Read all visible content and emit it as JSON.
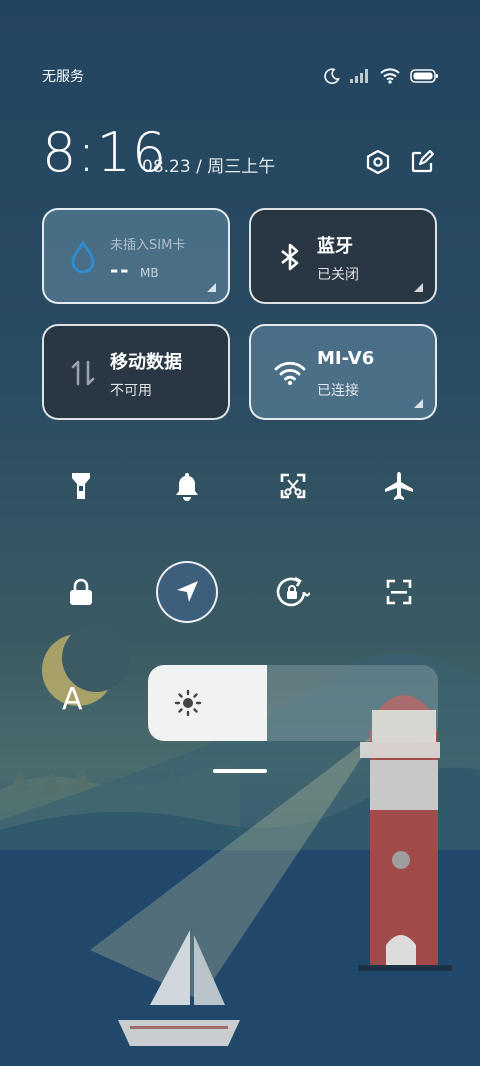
{
  "status_bar": {
    "carrier": "无服务",
    "icons": [
      "moon-icon",
      "signal-icon",
      "wifi-icon",
      "battery-icon"
    ]
  },
  "header": {
    "time": "8:16",
    "date": "08.23 / 周三上午",
    "buttons": [
      "settings-icon",
      "edit-icon"
    ]
  },
  "tiles": [
    {
      "id": "data-usage",
      "icon": "drop-icon",
      "title": "未插入SIM卡",
      "value": "--",
      "unit": "MB",
      "state": "on"
    },
    {
      "id": "bluetooth",
      "icon": "bluetooth-icon",
      "title": "蓝牙",
      "subtitle": "已关闭",
      "state": "off"
    },
    {
      "id": "mobile-data",
      "icon": "mobile-data-icon",
      "title": "移动数据",
      "subtitle": "不可用",
      "state": "off"
    },
    {
      "id": "wifi",
      "icon": "wifi-icon",
      "title": "MI-V6",
      "subtitle": "已连接",
      "state": "on"
    }
  ],
  "toggles_row1": [
    "flashlight-icon",
    "bell-icon",
    "screenshot-icon",
    "airplane-icon"
  ],
  "toggles_row2": [
    "lock-icon",
    "location-icon",
    "rotation-lock-icon",
    "scan-icon"
  ],
  "toggles_active": [
    "location-icon"
  ],
  "brightness": {
    "level": 0.41,
    "auto_label": "A"
  },
  "colors": {
    "accent": "#2e8fd8",
    "tile_dark": "#28343e",
    "tile_light": "#648ca5"
  }
}
